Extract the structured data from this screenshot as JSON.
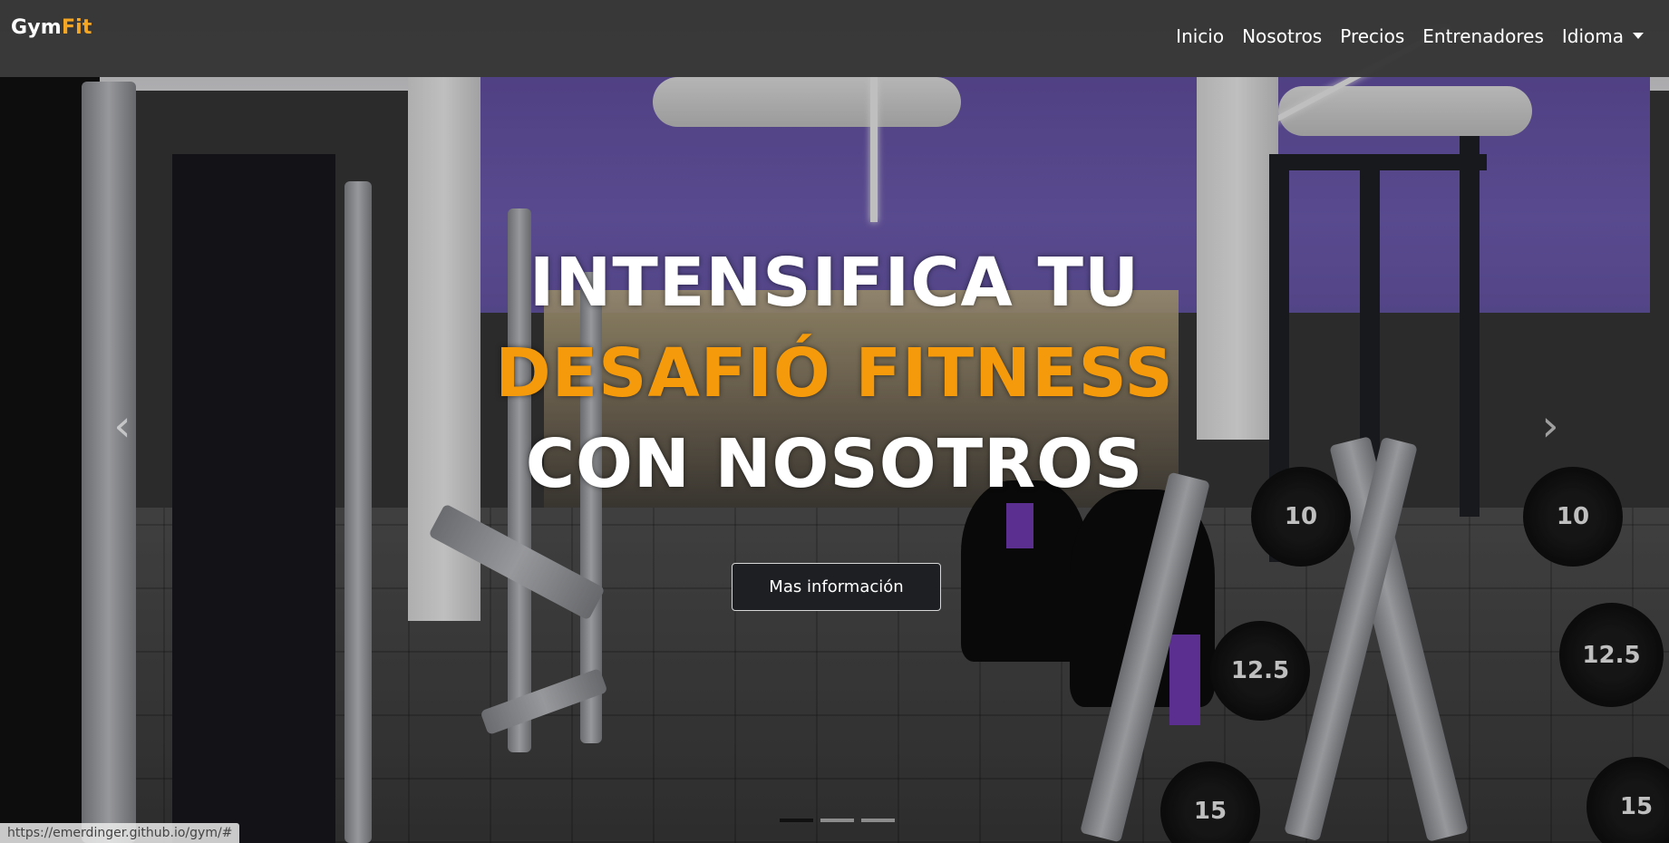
{
  "navbar": {
    "brand_main": "Gym",
    "brand_accent": "Fit",
    "links": [
      {
        "label": "Inicio"
      },
      {
        "label": "Nosotros"
      },
      {
        "label": "Precios"
      },
      {
        "label": "Entrenadores"
      },
      {
        "label": "Idioma"
      }
    ]
  },
  "hero": {
    "line1": "INTENSIFICA TU",
    "line2": "DESAFIÓ FITNESS",
    "line3": "CON NOSOTROS",
    "cta_label": "Mas información",
    "prev_glyph": "‹",
    "next_glyph": "›",
    "slides_total": 3,
    "active_slide": 1
  },
  "plates": [
    "10",
    "10",
    "12.5",
    "12.5",
    "15",
    "15"
  ],
  "status_bar": {
    "url": "https://emerdinger.github.io/gym/#"
  },
  "colors": {
    "accent": "#f5a623",
    "headline_orange": "#f59b0b",
    "navbar_bg": "#303030",
    "button_bg": "#1d1f22",
    "wall_purple": "#6b56b0"
  }
}
